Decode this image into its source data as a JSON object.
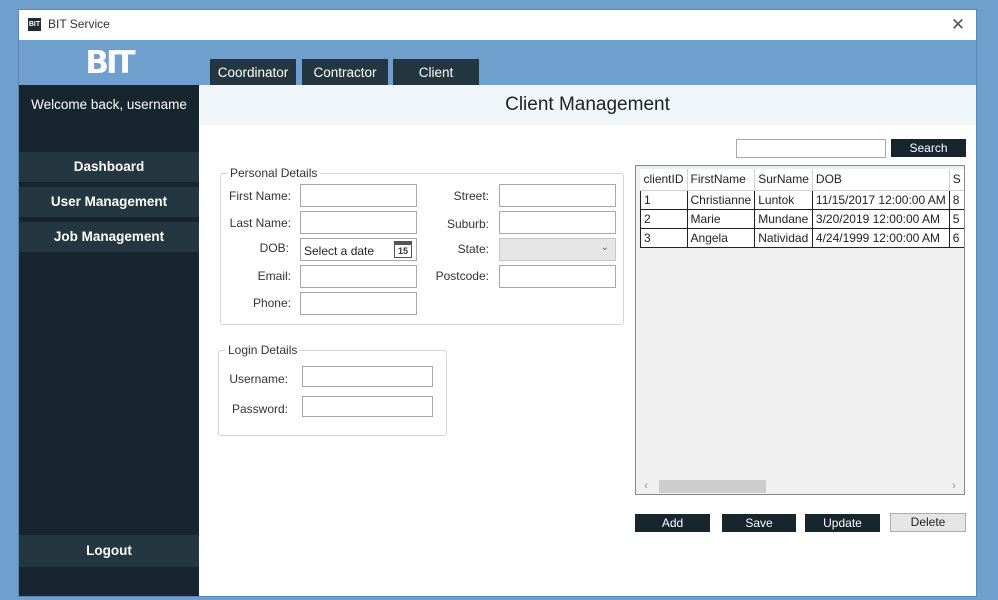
{
  "window": {
    "title": "BIT Service",
    "close_glyph": "✕"
  },
  "sidebar": {
    "logo": "BIT",
    "welcome": "Welcome back, username",
    "items": [
      {
        "label": "Dashboard"
      },
      {
        "label": "User Management"
      },
      {
        "label": "Job Management"
      }
    ],
    "logout": "Logout"
  },
  "tabs": [
    {
      "label": "Coordinator"
    },
    {
      "label": "Contractor"
    },
    {
      "label": "Client",
      "active": true
    }
  ],
  "page": {
    "title": "Client Management"
  },
  "personal": {
    "legend": "Personal Details",
    "first_name_label": "First Name:",
    "last_name_label": "Last Name:",
    "dob_label": "DOB:",
    "dob_placeholder": "Select a date",
    "calendar_day": "15",
    "email_label": "Email:",
    "phone_label": "Phone:",
    "street_label": "Street:",
    "suburb_label": "Suburb:",
    "state_label": "State:",
    "postcode_label": "Postcode:"
  },
  "login": {
    "legend": "Login Details",
    "username_label": "Username:",
    "password_label": "Password:"
  },
  "search": {
    "button": "Search",
    "value": ""
  },
  "grid": {
    "columns": [
      "clientID",
      "FirstName",
      "SurName",
      "DOB",
      "S"
    ],
    "rows": [
      [
        "1",
        "Christianne",
        "Luntok",
        "11/15/2017 12:00:00 AM",
        "8"
      ],
      [
        "2",
        "Marie",
        "Mundane",
        "3/20/2019 12:00:00 AM",
        "5"
      ],
      [
        "3",
        "Angela",
        "Natividad",
        "4/24/1999 12:00:00 AM",
        "6"
      ]
    ]
  },
  "actions": {
    "add": "Add",
    "save": "Save",
    "update": "Update",
    "delete": "Delete"
  },
  "colors": {
    "accent": "#6f9fcc",
    "sidebar": "#17252f",
    "nav": "#243640"
  }
}
